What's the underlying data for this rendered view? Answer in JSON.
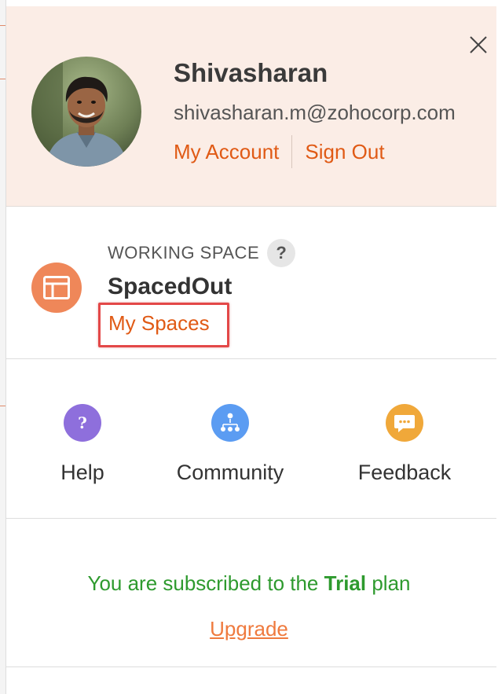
{
  "user": {
    "name": "Shivasharan",
    "email": "shivasharan.m@zohocorp.com",
    "my_account_label": "My Account",
    "sign_out_label": "Sign Out"
  },
  "working_space": {
    "label": "WORKING SPACE",
    "help_glyph": "?",
    "name": "SpacedOut",
    "my_spaces_label": "My Spaces"
  },
  "actions": [
    {
      "label": "Help",
      "icon": "question-icon",
      "color": "#8e6fdc"
    },
    {
      "label": "Community",
      "icon": "community-icon",
      "color": "#5b9cf2"
    },
    {
      "label": "Feedback",
      "icon": "chat-bubble-icon",
      "color": "#f0a83a"
    }
  ],
  "subscription": {
    "prefix": "You are subscribed to the ",
    "plan": "Trial",
    "suffix": " plan",
    "upgrade_label": "Upgrade"
  },
  "colors": {
    "accent": "#e05a15",
    "header_bg": "#fbede6",
    "highlight_box": "#e34848",
    "success_text": "#2e9a2e",
    "workspace_icon": "#ef8759"
  }
}
